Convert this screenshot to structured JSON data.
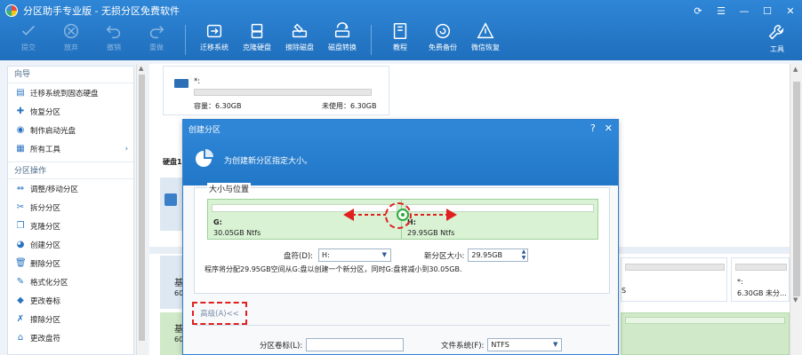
{
  "window": {
    "title": "分区助手专业版 - 无损分区免费软件"
  },
  "toolbar": {
    "items": [
      {
        "label": "提交",
        "icon": "check-icon",
        "disabled": true
      },
      {
        "label": "放弃",
        "icon": "cancel-icon",
        "disabled": true
      },
      {
        "label": "撤销",
        "icon": "undo-icon",
        "disabled": true
      },
      {
        "label": "重做",
        "icon": "redo-icon",
        "disabled": true
      },
      {
        "label": "迁移系统",
        "icon": "migrate-os-icon",
        "disabled": false
      },
      {
        "label": "克隆硬盘",
        "icon": "clone-disk-icon",
        "disabled": false
      },
      {
        "label": "擦除磁盘",
        "icon": "wipe-disk-icon",
        "disabled": false
      },
      {
        "label": "磁盘转换",
        "icon": "convert-disk-icon",
        "disabled": false
      },
      {
        "label": "教程",
        "icon": "tutorial-icon",
        "disabled": false
      },
      {
        "label": "免费备份",
        "icon": "backup-icon",
        "disabled": false
      },
      {
        "label": "微信恢复",
        "icon": "recovery-icon",
        "disabled": false
      }
    ],
    "tools_label": "工具"
  },
  "sidebar": {
    "wizard_header": "向导",
    "wizard_items": [
      {
        "label": "迁移系统到固态硬盘",
        "icon": "ssd-icon"
      },
      {
        "label": "恢复分区",
        "icon": "recover-icon"
      },
      {
        "label": "制作启动光盘",
        "icon": "bootdisk-icon"
      },
      {
        "label": "所有工具",
        "icon": "tools-icon",
        "arrow": "›"
      }
    ],
    "ops_header": "分区操作",
    "ops_items": [
      {
        "label": "调整/移动分区",
        "icon": "resize-icon"
      },
      {
        "label": "拆分分区",
        "icon": "split-icon"
      },
      {
        "label": "克隆分区",
        "icon": "clone-icon"
      },
      {
        "label": "创建分区",
        "icon": "create-icon"
      },
      {
        "label": "删除分区",
        "icon": "delete-icon"
      },
      {
        "label": "格式化分区",
        "icon": "format-icon"
      },
      {
        "label": "更改卷标",
        "icon": "label-icon"
      },
      {
        "label": "擦除分区",
        "icon": "wipe-icon"
      },
      {
        "label": "更改盘符",
        "icon": "letter-icon"
      }
    ]
  },
  "main": {
    "disk1": {
      "name": "*:",
      "capacity": "容量：6.30GB",
      "free": "未使用：6.30GB"
    },
    "disk_label": "硬盘1",
    "left_panel_text1": "基",
    "left_panel_text2": "60",
    "left_panel2_text1": "基",
    "left_panel2_text2": "60",
    "right_panel1_text": "S",
    "right_panel2_line1": "*:",
    "right_panel2_line2": "6.30GB 未分..."
  },
  "dialog": {
    "title": "创建分区",
    "help": "?",
    "close": "✕",
    "banner_text": "为创建新分区指定大小。",
    "group_title": "大小与位置",
    "partitions": [
      {
        "letter": "G:",
        "desc": "30.05GB Ntfs"
      },
      {
        "letter": "H:",
        "desc": "29.95GB Ntfs"
      }
    ],
    "drive_letter_label": "盘符(D):",
    "drive_letter_value": "H:",
    "new_size_label": "新分区大小:",
    "new_size_value": "29.95GB",
    "info_text": "程序将分配29.95GB空间从G:盘以创建一个新分区，同时G:盘将减小到30.05GB.",
    "advanced_label": "高级(A)<<",
    "volume_label": "分区卷标(L):",
    "volume_value": "",
    "fs_label": "文件系统(F):",
    "fs_value": "NTFS"
  },
  "colors": {
    "accent": "#2f86d6",
    "partition_fill": "#d8f2d3",
    "highlight": "#e02020"
  }
}
